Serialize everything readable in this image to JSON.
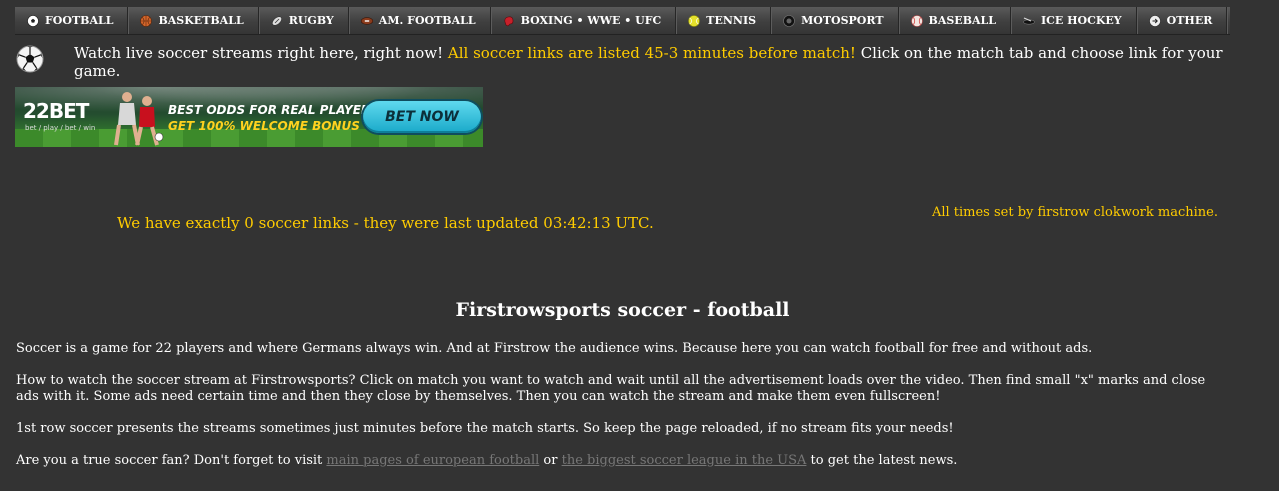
{
  "nav": {
    "items": [
      {
        "label": "FOOTBALL",
        "icon": "soccer-ball-icon"
      },
      {
        "label": "BASKETBALL",
        "icon": "basketball-icon"
      },
      {
        "label": "RUGBY",
        "icon": "rugby-ball-icon"
      },
      {
        "label": "AM. FOOTBALL",
        "icon": "american-football-icon"
      },
      {
        "label": "BOXING • WWE • UFC",
        "icon": "boxing-glove-icon"
      },
      {
        "label": "TENNIS",
        "icon": "tennis-ball-icon"
      },
      {
        "label": "MOTOSPORT",
        "icon": "tire-icon"
      },
      {
        "label": "BASEBALL",
        "icon": "baseball-icon"
      },
      {
        "label": "ICE HOCKEY",
        "icon": "hockey-puck-icon"
      },
      {
        "label": "OTHER",
        "icon": "arrow-circle-icon"
      }
    ]
  },
  "intro": {
    "part1": "Watch live soccer streams right here, right now! ",
    "highlight": "All soccer links are listed 45-3 minutes before match!",
    "part2": " Click on the match tab and choose link for your game."
  },
  "banner": {
    "logo_text": "22BET",
    "logo_sub": "bet / play / bet / win",
    "line1": "BEST ODDS FOR REAL PLAYERS",
    "line2": "GET 100% WELCOME BONUS",
    "cta": "BET NOW"
  },
  "status": {
    "links_count": "We have exactly 0 soccer links - they were last updated 03:42:13 UTC.",
    "times_note": "All times set by firstrow clokwork machine."
  },
  "article": {
    "title": "Firstrowsports soccer - football",
    "p1": "Soccer is a game for 22 players and where Germans always win. And at Firstrow the audience wins. Because here you can watch football for free and without ads.",
    "p2": "How to watch the soccer stream at Firstrowsports? Click on match you want to watch and wait until all the advertisement loads over the video. Then find small \"x\" marks and close ads with it. Some ads need certain time and then they close by themselves. Then you can watch the stream and make them even fullscreen!",
    "p3": "1st row soccer presents the streams sometimes just minutes before the match starts. So keep the page reloaded, if no stream fits your needs!",
    "p4_pre": "Are you a true soccer fan? Don't forget to visit ",
    "link1": "main pages of european football",
    "p4_mid": " or ",
    "link2": "the biggest soccer league in the USA",
    "p4_post": " to get the latest news."
  },
  "colors": {
    "background": "#333333",
    "highlight": "#ffcc00",
    "link": "#777777"
  }
}
